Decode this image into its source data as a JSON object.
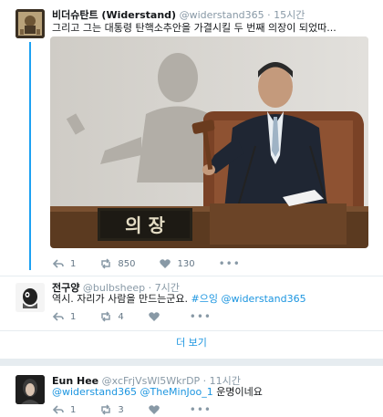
{
  "main_tweet": {
    "author_name": "비더슈탄트 (Widerstand)",
    "handle": "@widerstand365",
    "dot": "·",
    "time": "15시간",
    "text": "그리고 그는 대통령 탄핵소추안을 가결시킬 두 번째 의장이 되었따...",
    "photo_sign_text": "의 장",
    "actions": {
      "reply_count": "1",
      "retweet_count": "850",
      "like_count": "130"
    }
  },
  "reply_1": {
    "author_name": "전구양",
    "handle": "@bulbsheep",
    "dot": "·",
    "time": "7시간",
    "text_plain": "역시. 자리가 사람을 만드는군요. ",
    "hashtag": "#으잉",
    "mention": " @widerstand365",
    "actions": {
      "reply_count": "1",
      "retweet_count": "4",
      "like_count": ""
    }
  },
  "show_more_label": "더 보기",
  "reply_2": {
    "author_name": "Eun Hee",
    "handle": "@xcFrjVsWl5WkrDP",
    "dot": "·",
    "time": "11시간",
    "mention_1": "@widerstand365",
    "mention_2": " @TheMinJoo_1",
    "text_suffix": " 운명이네요",
    "actions": {
      "reply_count": "1",
      "retweet_count": "3",
      "like_count": ""
    }
  },
  "colors": {
    "link": "#1b95e0",
    "thread_line": "#1da1f2",
    "muted": "#8899a6",
    "page_bg": "#e6ecf0"
  }
}
